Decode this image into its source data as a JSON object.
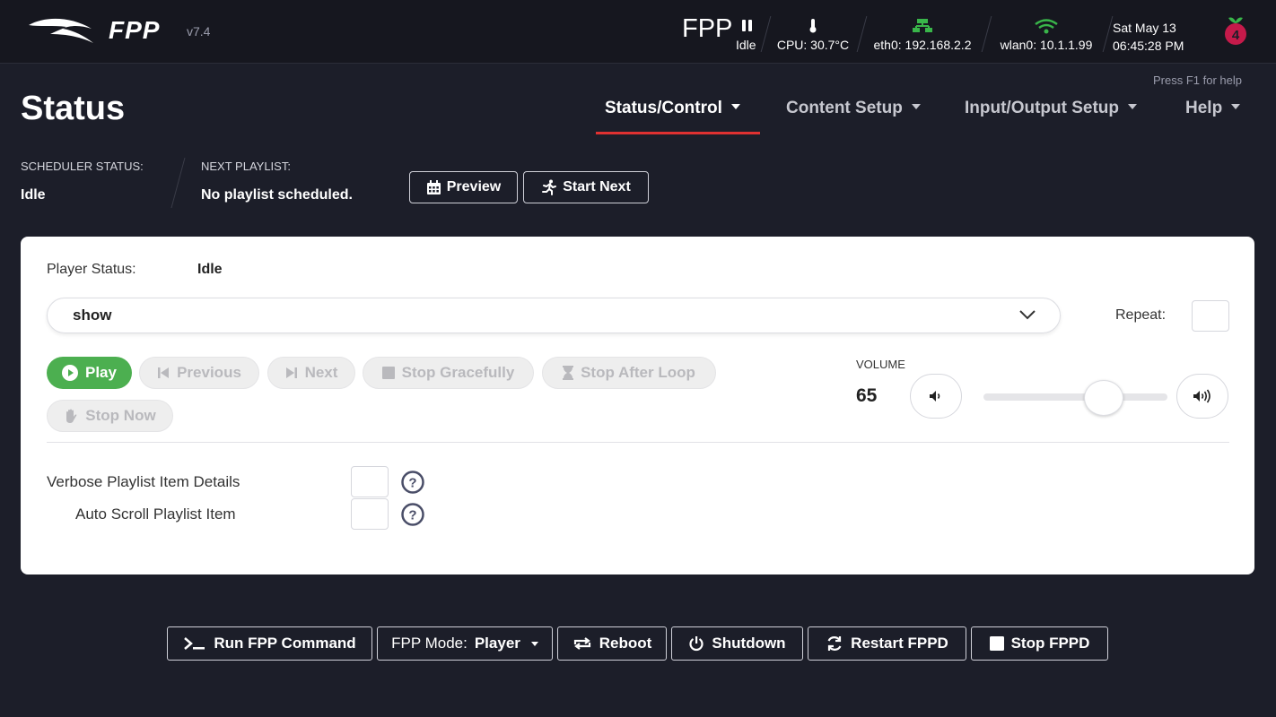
{
  "header": {
    "brand": "FPP",
    "version": "v7.4",
    "fpp_name": "FPP",
    "fpp_state": "Idle",
    "cpu": "CPU: 30.7°C",
    "eth": "eth0: 192.168.2.2",
    "wlan": "wlan0: 10.1.1.99",
    "date": "Sat May 13",
    "time": "06:45:28 PM",
    "icons": {
      "pause": "pause-icon",
      "temp": "thermometer-icon",
      "network": "network-icon",
      "wifi": "wifi-icon",
      "board": "raspberry-pi-logo"
    },
    "colors": {
      "network": "#39b54a",
      "wifi": "#39b54a",
      "pi": "#c51a4a"
    }
  },
  "help_hint": "Press F1 for help",
  "page_title": "Status",
  "nav": [
    {
      "label": "Status/Control",
      "active": true
    },
    {
      "label": "Content Setup"
    },
    {
      "label": "Input/Output Setup"
    },
    {
      "label": "Help"
    }
  ],
  "nav_accent": "#e03131",
  "scheduler": {
    "status_label": "SCHEDULER STATUS:",
    "status_value": "Idle",
    "next_label": "NEXT PLAYLIST:",
    "next_value": "No playlist scheduled.",
    "preview_label": "Preview",
    "start_next_label": "Start Next"
  },
  "player": {
    "status_label": "Player Status:",
    "status_value": "Idle",
    "playlist_selected": "show",
    "repeat_label": "Repeat:",
    "buttons": {
      "play": "Play",
      "previous": "Previous",
      "next": "Next",
      "stop_gracefully": "Stop Gracefully",
      "stop_after_loop": "Stop After Loop",
      "stop_now": "Stop Now"
    },
    "play_color": "#4caf50",
    "volume_label": "VOLUME",
    "volume_value": "65",
    "volume_level_percent": 65,
    "options": {
      "verbose": "Verbose Playlist Item Details",
      "autoscroll": "Auto Scroll Playlist Item"
    }
  },
  "bottom": {
    "run_cmd": "Run FPP Command",
    "mode_prefix": "FPP Mode:",
    "mode_value": "Player",
    "reboot": "Reboot",
    "shutdown": "Shutdown",
    "restart": "Restart FPPD",
    "stop": "Stop FPPD"
  }
}
